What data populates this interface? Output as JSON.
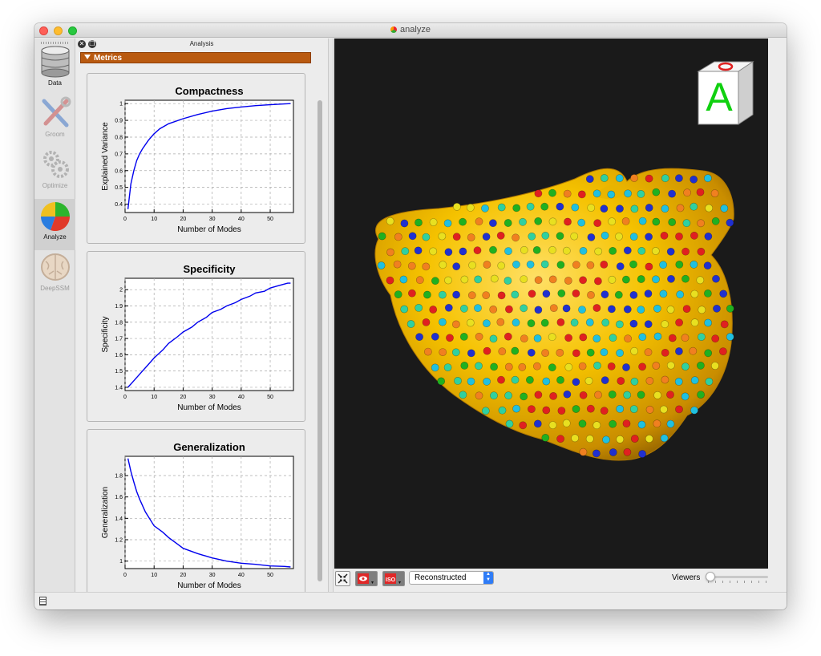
{
  "window": {
    "title": "analyze"
  },
  "toolbar": {
    "items": [
      {
        "label": "Data",
        "icon": "database-icon",
        "active": false,
        "enabled": true
      },
      {
        "label": "Groom",
        "icon": "groom-tools-icon",
        "active": false,
        "enabled": false
      },
      {
        "label": "Optimize",
        "icon": "gears-icon",
        "active": false,
        "enabled": false
      },
      {
        "label": "Analyze",
        "icon": "pie-chart-icon",
        "active": true,
        "enabled": true
      },
      {
        "label": "DeepSSM",
        "icon": "brain-icon",
        "active": false,
        "enabled": false
      }
    ]
  },
  "panel": {
    "title": "Analysis",
    "section": "Metrics"
  },
  "chart_data": [
    {
      "type": "line",
      "title": "Compactness",
      "xlabel": "Number of Modes",
      "ylabel": "Explained Variance",
      "xlim": [
        0,
        58
      ],
      "ylim": [
        0.35,
        1.02
      ],
      "xticks": [
        0,
        10,
        20,
        30,
        40,
        50
      ],
      "yticks": [
        0.4,
        0.5,
        0.6,
        0.7,
        0.8,
        0.9,
        1
      ],
      "grid": true,
      "color": "#0000ee",
      "x": [
        1,
        2,
        3,
        4,
        5,
        6,
        8,
        10,
        12,
        15,
        20,
        25,
        30,
        35,
        40,
        45,
        50,
        55,
        57
      ],
      "y": [
        0.37,
        0.52,
        0.6,
        0.66,
        0.7,
        0.73,
        0.78,
        0.82,
        0.85,
        0.88,
        0.91,
        0.935,
        0.955,
        0.97,
        0.98,
        0.988,
        0.993,
        0.998,
        1.0
      ]
    },
    {
      "type": "line",
      "title": "Specificity",
      "xlabel": "Number of Modes",
      "ylabel": "Specificity",
      "xlim": [
        0,
        58
      ],
      "ylim": [
        1.38,
        2.07
      ],
      "xticks": [
        0,
        10,
        20,
        30,
        40,
        50
      ],
      "yticks": [
        1.4,
        1.5,
        1.6,
        1.7,
        1.8,
        1.9,
        2
      ],
      "grid": true,
      "color": "#0000ee",
      "x": [
        1,
        3,
        5,
        8,
        10,
        13,
        15,
        18,
        20,
        23,
        25,
        28,
        30,
        33,
        35,
        38,
        40,
        43,
        45,
        48,
        50,
        52,
        54,
        56,
        57
      ],
      "y": [
        1.4,
        1.44,
        1.48,
        1.54,
        1.58,
        1.63,
        1.67,
        1.71,
        1.74,
        1.77,
        1.8,
        1.83,
        1.86,
        1.88,
        1.9,
        1.92,
        1.94,
        1.96,
        1.98,
        1.99,
        2.01,
        2.02,
        2.03,
        2.04,
        2.04
      ]
    },
    {
      "type": "line",
      "title": "Generalization",
      "xlabel": "Number of Modes",
      "ylabel": "Generalization",
      "xlim": [
        0,
        58
      ],
      "ylim": [
        0.93,
        1.98
      ],
      "xticks": [
        0,
        10,
        20,
        30,
        40,
        50
      ],
      "yticks": [
        1,
        1.2,
        1.4,
        1.6,
        1.8
      ],
      "grid": true,
      "color": "#0000ee",
      "x": [
        1,
        2,
        3,
        4,
        5,
        7,
        10,
        13,
        15,
        18,
        20,
        25,
        30,
        35,
        40,
        45,
        50,
        55,
        57
      ],
      "y": [
        1.96,
        1.84,
        1.74,
        1.65,
        1.58,
        1.46,
        1.33,
        1.27,
        1.22,
        1.16,
        1.12,
        1.07,
        1.03,
        1.0,
        0.98,
        0.97,
        0.955,
        0.95,
        0.945
      ]
    }
  ],
  "viewer": {
    "orientation_marker": "A",
    "background": "#1a1a1a",
    "surface_color": "#f2c200",
    "particle_colors": [
      "#e02020",
      "#20b020",
      "#e8e020",
      "#20c0e0",
      "#2030d0",
      "#f08020",
      "#30d0a0"
    ]
  },
  "view_bar": {
    "display_mode": "Reconstructed",
    "viewers_label": "Viewers",
    "viewers_slider_fraction": 0.0,
    "buttons": [
      "autoview-icon",
      "glyph-visibility-icon",
      "isosurface-icon"
    ]
  },
  "statusbar": {
    "icon": "log-icon"
  }
}
